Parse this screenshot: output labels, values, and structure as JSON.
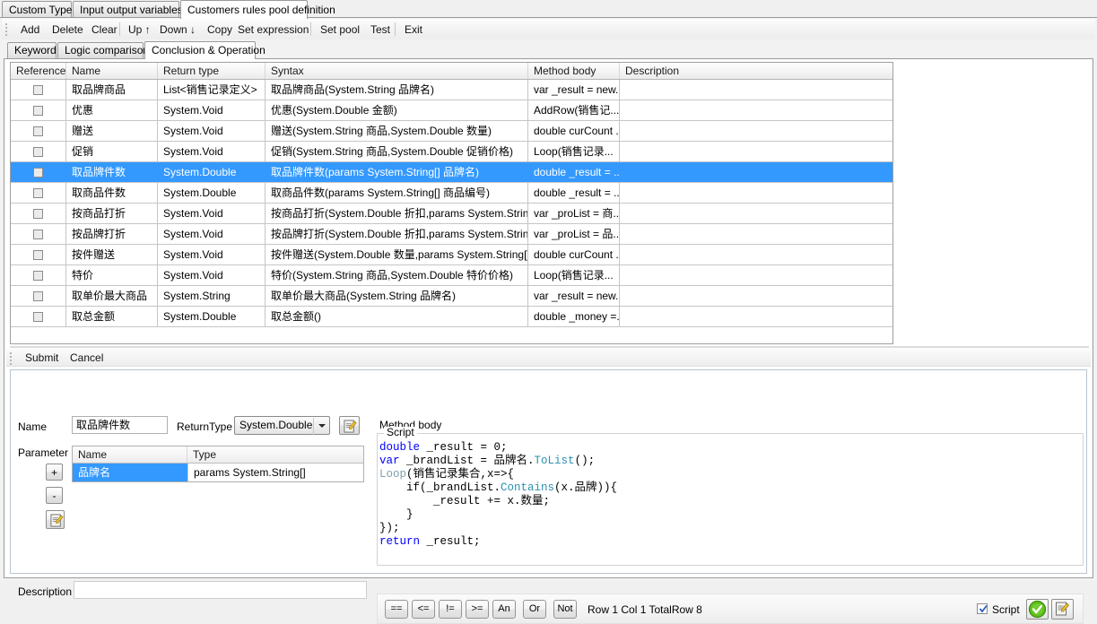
{
  "window": {
    "outer_tabs": [
      {
        "label": "Custom Types",
        "active": false
      },
      {
        "label": "Input output variables",
        "active": false
      },
      {
        "label": "Customers rules pool  definition",
        "active": true
      }
    ]
  },
  "toolbar": {
    "items": [
      {
        "label": "Add"
      },
      {
        "label": "Delete"
      },
      {
        "label": "Clear"
      },
      {
        "label": "Up ↑"
      },
      {
        "label": "Down ↓"
      },
      {
        "label": "Copy"
      },
      {
        "label": "Set expression"
      },
      {
        "label": "Set pool"
      },
      {
        "label": "Test"
      },
      {
        "label": "Exit"
      }
    ]
  },
  "inner_tabs": [
    {
      "label": "Keyword",
      "active": false
    },
    {
      "label": "Logic comparison",
      "active": false
    },
    {
      "label": "Conclusion & Operation",
      "active": true
    }
  ],
  "grid": {
    "columns": [
      "Reference",
      "Name",
      "Return type",
      "Syntax",
      "Method body",
      "Description"
    ],
    "rows": [
      {
        "ref": "",
        "name": "取品牌商品",
        "return_type": "List<销售记录定义>",
        "syntax": "取品牌商品(System.String 品牌名)",
        "method_body": "var _result = new...",
        "description": "",
        "selected": false
      },
      {
        "ref": "",
        "name": "优惠",
        "return_type": "System.Void",
        "syntax": "优惠(System.Double 金额)",
        "method_body": "AddRow(销售记...",
        "description": "",
        "selected": false
      },
      {
        "ref": "",
        "name": "赠送",
        "return_type": "System.Void",
        "syntax": "赠送(System.String 商品,System.Double 数量)",
        "method_body": "double curCount ...",
        "description": "",
        "selected": false
      },
      {
        "ref": "",
        "name": "促销",
        "return_type": "System.Void",
        "syntax": "促销(System.String 商品,System.Double 促销价格)",
        "method_body": "Loop(销售记录...",
        "description": "",
        "selected": false
      },
      {
        "ref": "",
        "name": "取品牌件数",
        "return_type": "System.Double",
        "syntax": "取品牌件数(params System.String[] 品牌名)",
        "method_body": "double _result = ...",
        "description": "",
        "selected": true
      },
      {
        "ref": "",
        "name": "取商品件数",
        "return_type": "System.Double",
        "syntax": "取商品件数(params System.String[] 商品编号)",
        "method_body": "double _result = ...",
        "description": "",
        "selected": false
      },
      {
        "ref": "",
        "name": "按商品打折",
        "return_type": "System.Void",
        "syntax": "按商品打折(System.Double 折扣,params System.String[] ...",
        "method_body": "var _proList = 商...",
        "description": "",
        "selected": false
      },
      {
        "ref": "",
        "name": "按品牌打折",
        "return_type": "System.Void",
        "syntax": "按品牌打折(System.Double 折扣,params System.String[] ...",
        "method_body": "var _proList = 品...",
        "description": "",
        "selected": false
      },
      {
        "ref": "",
        "name": "按件赠送",
        "return_type": "System.Void",
        "syntax": "按件赠送(System.Double 数量,params System.String[] 商...",
        "method_body": "double curCount ...",
        "description": "",
        "selected": false
      },
      {
        "ref": "",
        "name": "特价",
        "return_type": "System.Void",
        "syntax": "特价(System.String 商品,System.Double 特价价格)",
        "method_body": "Loop(销售记录...",
        "description": "",
        "selected": false
      },
      {
        "ref": "",
        "name": "取单价最大商品",
        "return_type": "System.String",
        "syntax": "取单价最大商品(System.String 品牌名)",
        "method_body": "var _result = new...",
        "description": "",
        "selected": false
      },
      {
        "ref": "",
        "name": "取总金额",
        "return_type": "System.Double",
        "syntax": "取总金额()",
        "method_body": "double _money =...",
        "description": "",
        "selected": false
      }
    ]
  },
  "submit_bar": {
    "submit_label": "Submit",
    "cancel_label": "Cancel"
  },
  "form": {
    "name_label": "Name",
    "name_value": "取品牌件数",
    "return_type_label": "ReturnType",
    "return_type_value": "System.Double",
    "parameter_label": "Parameter",
    "add_param_label": "+",
    "remove_param_label": "-",
    "param_columns": [
      "Name",
      "Type"
    ],
    "param_rows": [
      {
        "name": "品牌名",
        "type": "params System.String[]"
      }
    ],
    "description_label": "Description",
    "description_value": ""
  },
  "method_body": {
    "title": "Method body",
    "group_title": "Script",
    "code_lines": [
      [
        {
          "t": "double",
          "c": "k"
        },
        {
          "t": " _result = 0;",
          "c": ""
        }
      ],
      [
        {
          "t": "var",
          "c": "k"
        },
        {
          "t": " _brandList = 品牌名.",
          "c": ""
        },
        {
          "t": "ToList",
          "c": "t"
        },
        {
          "t": "();",
          "c": ""
        }
      ],
      [
        {
          "t": "Loop",
          "c": "g"
        },
        {
          "t": "(销售记录集合,x=>{",
          "c": ""
        }
      ],
      [
        {
          "t": "    if(_brandList.",
          "c": ""
        },
        {
          "t": "Contains",
          "c": "t"
        },
        {
          "t": "(x.品牌)){",
          "c": ""
        }
      ],
      [
        {
          "t": "        _result += x.数量;",
          "c": ""
        }
      ],
      [
        {
          "t": "    }",
          "c": ""
        }
      ],
      [
        {
          "t": "});",
          "c": ""
        }
      ],
      [
        {
          "t": "return",
          "c": "k"
        },
        {
          "t": " _result;",
          "c": ""
        }
      ]
    ]
  },
  "op_bar": {
    "buttons": [
      "==",
      "<=",
      "!=",
      ">=",
      "An",
      "Or",
      "Not"
    ],
    "status": "Row 1 Col 1  TotalRow 8",
    "script_checkbox_label": "Script",
    "script_checked": true
  },
  "colors": {
    "selection": "#3399ff",
    "keyword": "#0000ff",
    "type": "#2b91af",
    "accent_green": "#4cb723"
  }
}
